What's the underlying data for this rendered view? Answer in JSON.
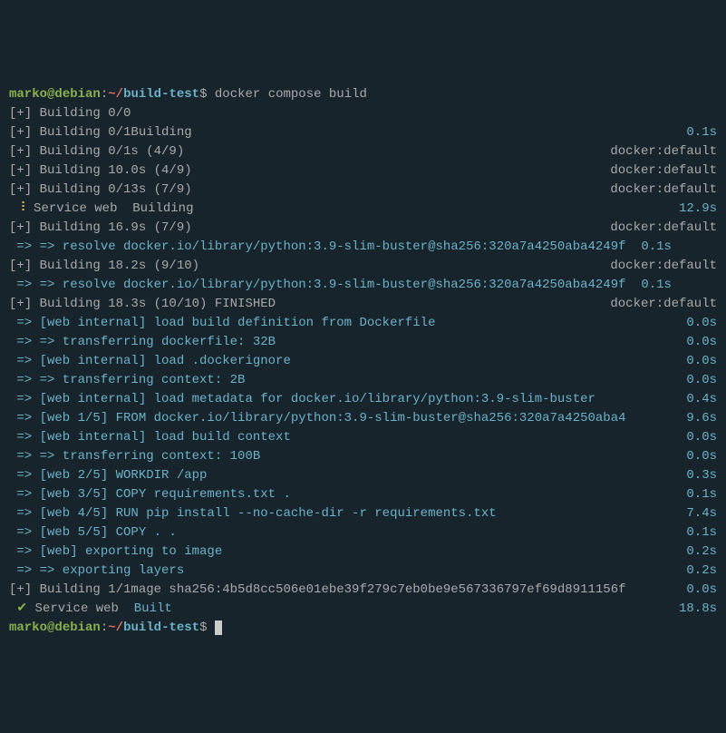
{
  "prompt": {
    "user": "marko",
    "at": "@",
    "host": "debian",
    "colon": ":",
    "tilde": "~/",
    "path": "build-test",
    "dollar": "$"
  },
  "cmd": " docker compose build",
  "lines": [
    {
      "l": "[+] Building 0/0",
      "r": ""
    },
    {
      "l": "[+] Building 0/1Building",
      "r": "0.1s",
      "rc": "cyan"
    },
    {
      "l": "[+] Building 0/1s (4/9)",
      "r": "docker:default"
    },
    {
      "l": "[+] Building 10.0s (4/9)",
      "r": "docker:default"
    },
    {
      "l": "[+] Building 0/13s (7/9)",
      "r": "docker:default"
    },
    {
      "l_html": "<span class='yellow'> ⠸</span><span class='grey'> Service web  Building</span>",
      "r": "12.9s",
      "rc": "cyan"
    },
    {
      "l": "[+] Building 16.9s (7/9)",
      "r": "docker:default"
    },
    {
      "l_html": "<span class='cyan'> => => resolve docker.io/library/python:3.9-slim-buster@sha256:320a7a4250aba4249f  0.1s</span>",
      "r": ""
    },
    {
      "l": "[+] Building 18.2s (9/10)",
      "r": "docker:default"
    },
    {
      "l_html": "<span class='cyan'> => => resolve docker.io/library/python:3.9-slim-buster@sha256:320a7a4250aba4249f  0.1s</span>",
      "r": ""
    },
    {
      "l": "[+] Building 18.3s (10/10) FINISHED",
      "r": "docker:default"
    },
    {
      "l_html": "<span class='cyan'> => [web internal] load build definition from Dockerfile</span>",
      "r": "0.0s",
      "rc": "cyan"
    },
    {
      "l_html": "<span class='cyan'> => => transferring dockerfile: 32B</span>",
      "r": "0.0s",
      "rc": "cyan"
    },
    {
      "l_html": "<span class='cyan'> => [web internal] load .dockerignore</span>",
      "r": "0.0s",
      "rc": "cyan"
    },
    {
      "l_html": "<span class='cyan'> => => transferring context: 2B</span>",
      "r": "0.0s",
      "rc": "cyan"
    },
    {
      "l_html": "<span class='cyan'> => [web internal] load metadata for docker.io/library/python:3.9-slim-buster</span>",
      "r": "0.4s",
      "rc": "cyan"
    },
    {
      "l_html": "<span class='cyan'> => [web 1/5] FROM docker.io/library/python:3.9-slim-buster@sha256:320a7a4250aba4</span>",
      "r": "9.6s",
      "rc": "cyan"
    },
    {
      "l_html": "<span class='cyan'> => [web internal] load build context</span>",
      "r": "0.0s",
      "rc": "cyan"
    },
    {
      "l_html": "<span class='cyan'> => => transferring context: 100B</span>",
      "r": "0.0s",
      "rc": "cyan"
    },
    {
      "l_html": "<span class='cyan'> => [web 2/5] WORKDIR /app</span>",
      "r": "0.3s",
      "rc": "cyan"
    },
    {
      "l_html": "<span class='cyan'> => [web 3/5] COPY requirements.txt .</span>",
      "r": "0.1s",
      "rc": "cyan"
    },
    {
      "l_html": "<span class='cyan'> => [web 4/5] RUN pip install --no-cache-dir -r requirements.txt</span>",
      "r": "7.4s",
      "rc": "cyan"
    },
    {
      "l_html": "<span class='cyan'> => [web 5/5] COPY . .</span>",
      "r": "0.1s",
      "rc": "cyan"
    },
    {
      "l_html": "<span class='cyan'> => [web] exporting to image</span>",
      "r": "0.2s",
      "rc": "cyan"
    },
    {
      "l_html": "<span class='cyan'> => => exporting layers</span>",
      "r": "0.2s",
      "rc": "cyan"
    },
    {
      "l": "[+] Building 1/1mage sha256:4b5d8cc506e01ebe39f279c7eb0be9e567336797ef69d8911156f",
      "r": "0.0s",
      "rc": "cyan"
    },
    {
      "l_html": "<span class='green'> ✔</span><span class='grey'> Service web  </span><span class='cyan'>Built</span>",
      "r": "18.8s",
      "rc": "cyan"
    }
  ]
}
